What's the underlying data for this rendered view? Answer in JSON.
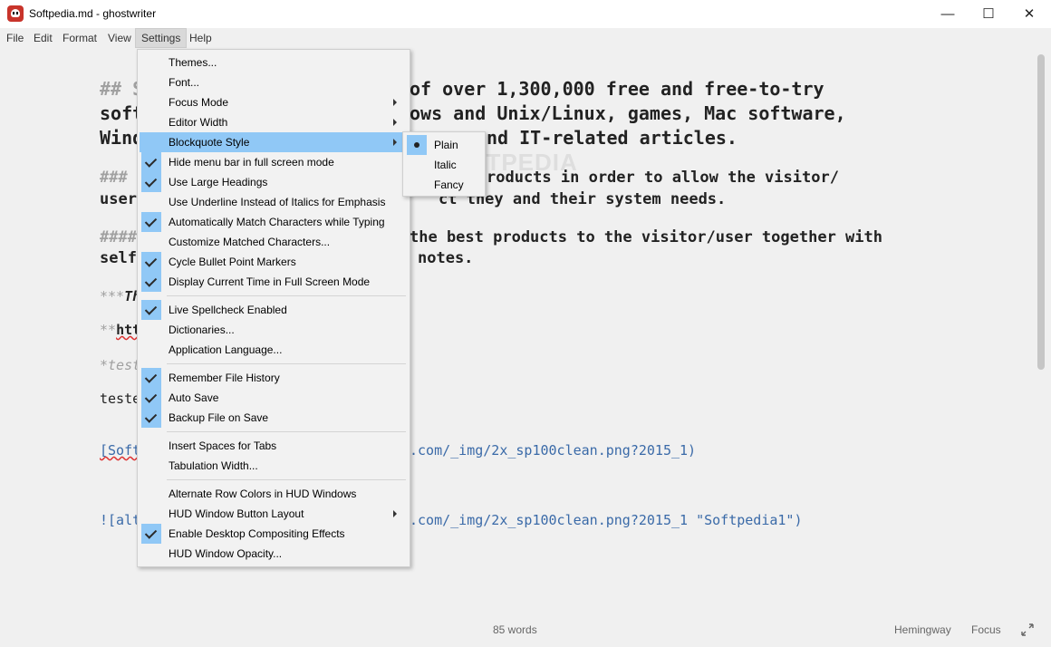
{
  "window": {
    "title": "Softpedia.md - ghostwriter",
    "controls": [
      "minimize-icon",
      "maximize-icon",
      "close-icon"
    ]
  },
  "menubar": {
    "items": [
      "File",
      "Edit",
      "Format",
      "View",
      "Settings",
      "Help"
    ],
    "active": "Settings"
  },
  "editor": {
    "line1a": "## S",
    "line1b": "of over 1,300,000 free and free-to-try",
    "line2a": "soft",
    "line2b": "ows and Unix/Linux, games, Mac software,",
    "line3a": "Wind",
    "line3b": "nd IT-related articles.",
    "line4a": "###",
    "line4b": "roducts in order to allow the visitor/",
    "line5a": "user",
    "line5b": "ct they and their system needs.",
    "line6a": "####",
    "line6b": "the best products to the visitor/user together with",
    "line7a": "self",
    "line7b": "notes.",
    "line8a": "***",
    "line8b": "Th",
    "line9a": "**",
    "line9b": "htt",
    "line10": "*test",
    "line11": "teste",
    "line12a": "[Soft",
    "line12b": ".com/_img/2x_sp100clean.png?2015_1)",
    "line13a": "![alt",
    "line13b": ".com/_img/2x_sp100clean.png?2015_1 \"Softpedia1\")",
    "watermark": "SOFTPEDIA"
  },
  "settings_menu": {
    "items": [
      {
        "label": "Themes...",
        "checked": false,
        "submenu": false
      },
      {
        "label": "Font...",
        "checked": false,
        "submenu": false
      },
      {
        "label": "Focus Mode",
        "checked": false,
        "submenu": true
      },
      {
        "label": "Editor Width",
        "checked": false,
        "submenu": true
      },
      {
        "label": "Blockquote Style",
        "checked": false,
        "submenu": true,
        "highlighted": true
      },
      {
        "label": "Hide menu bar in full screen mode",
        "checked": true,
        "submenu": false
      },
      {
        "label": "Use Large Headings",
        "checked": true,
        "submenu": false
      },
      {
        "label": "Use Underline Instead of Italics for Emphasis",
        "checked": false,
        "submenu": false
      },
      {
        "label": "Automatically Match Characters while Typing",
        "checked": true,
        "submenu": false
      },
      {
        "label": "Customize Matched Characters...",
        "checked": false,
        "submenu": false
      },
      {
        "label": "Cycle Bullet Point Markers",
        "checked": true,
        "submenu": false
      },
      {
        "label": "Display Current Time in Full Screen Mode",
        "checked": true,
        "submenu": false
      },
      {
        "label": "Live Spellcheck Enabled",
        "checked": true,
        "submenu": false
      },
      {
        "label": "Dictionaries...",
        "checked": false,
        "submenu": false
      },
      {
        "label": "Application Language...",
        "checked": false,
        "submenu": false
      },
      {
        "label": "Remember File History",
        "checked": true,
        "submenu": false
      },
      {
        "label": "Auto Save",
        "checked": true,
        "submenu": false
      },
      {
        "label": "Backup File on Save",
        "checked": true,
        "submenu": false
      },
      {
        "label": "Insert Spaces for Tabs",
        "checked": false,
        "submenu": false
      },
      {
        "label": "Tabulation Width...",
        "checked": false,
        "submenu": false
      },
      {
        "label": "Alternate Row Colors in HUD Windows",
        "checked": false,
        "submenu": false
      },
      {
        "label": "HUD Window Button Layout",
        "checked": false,
        "submenu": true
      },
      {
        "label": "Enable Desktop Compositing Effects",
        "checked": true,
        "submenu": false
      },
      {
        "label": "HUD Window Opacity...",
        "checked": false,
        "submenu": false
      }
    ]
  },
  "blockquote_submenu": {
    "items": [
      {
        "label": "Plain",
        "selected": true
      },
      {
        "label": "Italic",
        "selected": false
      },
      {
        "label": "Fancy",
        "selected": false
      }
    ]
  },
  "statusbar": {
    "word_count": "85 words",
    "hemingway": "Hemingway",
    "focus": "Focus"
  }
}
